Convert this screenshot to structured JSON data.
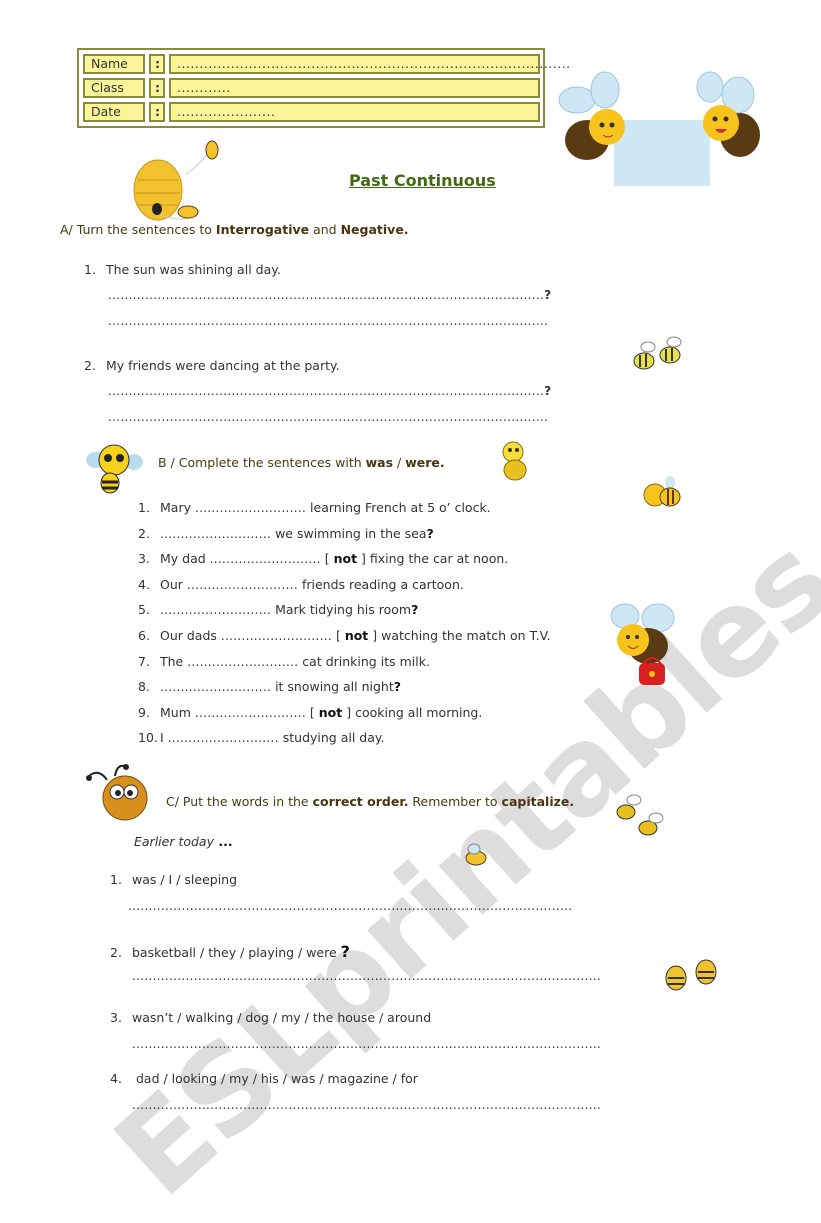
{
  "header": {
    "fields": [
      {
        "label": "Name",
        "sep": ":",
        "value": "........................................................................................"
      },
      {
        "label": "Class",
        "sep": ":",
        "value": "............"
      },
      {
        "label": "Date",
        "sep": ":",
        "value": "......................"
      }
    ]
  },
  "title": "Past Continuous",
  "section_a": {
    "instruction_prefix": "A/ Turn the sentences to ",
    "bold1": "Interrogative",
    "mid": " and ",
    "bold2": "Negative.",
    "items": [
      {
        "num": "1.",
        "text": "The sun was shining all day.",
        "line1": "..........................................................................................................",
        "end1": "?",
        "line2": "..........................................................................................................",
        "end2": "."
      },
      {
        "num": "2.",
        "text": "My friends were dancing at the party.",
        "line1": "..........................................................................................................",
        "end1": "?",
        "line2": "..........................................................................................................",
        "end2": "."
      }
    ]
  },
  "section_b": {
    "instruction_prefix": "B / Complete the sentences with ",
    "bold1": "was",
    "sep": " / ",
    "bold2": "were.",
    "blank": "...........................",
    "items": [
      {
        "num": "1.",
        "before": "Mary ",
        "after": " learning French at 5 o’ clock.",
        "not": "",
        "q": ""
      },
      {
        "num": "2.",
        "before": "",
        "after": " we swimming in the sea",
        "not": "",
        "q": "?"
      },
      {
        "num": "3.",
        "before": "My dad ",
        "after": " fixing the car at noon.",
        "not": "not",
        "q": ""
      },
      {
        "num": "4.",
        "before": "Our ",
        "after": " friends reading a cartoon.",
        "not": "",
        "q": ""
      },
      {
        "num": "5.",
        "before": "",
        "after": " Mark tidying his room",
        "not": "",
        "q": "?"
      },
      {
        "num": "6.",
        "before": "Our dads ",
        "after": " watching the match on T.V.",
        "not": "not",
        "q": ""
      },
      {
        "num": "7.",
        "before": "The ",
        "after": " cat drinking its milk.",
        "not": "",
        "q": ""
      },
      {
        "num": "8.",
        "before": "",
        "after": " it snowing all night",
        "not": "",
        "q": "?"
      },
      {
        "num": "9.",
        "before": "Mum ",
        "after": " cooking all morning.",
        "not": "not",
        "q": ""
      },
      {
        "num": "10.",
        "before": "I ",
        "after": " studying all day.",
        "not": "",
        "q": ""
      }
    ]
  },
  "section_c": {
    "instruction_prefix": "C/ Put the words in the ",
    "bold1": "correct order.",
    "mid": " Remember to ",
    "bold2": "capitalize.",
    "lead": "Earlier today",
    "lead_suffix": " ...",
    "items": [
      {
        "num": "1.",
        "words": "was / I / sleeping",
        "q": "",
        "line": "............................................................................................................"
      },
      {
        "num": "2.",
        "words": "basketball / they / playing / were ",
        "q": "?",
        "line": ".................................................................................................................."
      },
      {
        "num": "3.",
        "words": "wasn’t / walking / dog / my / the house / around",
        "q": "",
        "line": ".................................................................................................................."
      },
      {
        "num": "4.",
        "words": " dad / looking / my / his / was / magazine / for",
        "q": "",
        "line": ".................................................................................................................."
      }
    ]
  },
  "watermark": "ESLprintables.com",
  "colors": {
    "title": "#3f6b13",
    "header_fill": "#fbf59a",
    "header_border": "#8a8a3a",
    "instruction": "#4a3a12"
  }
}
